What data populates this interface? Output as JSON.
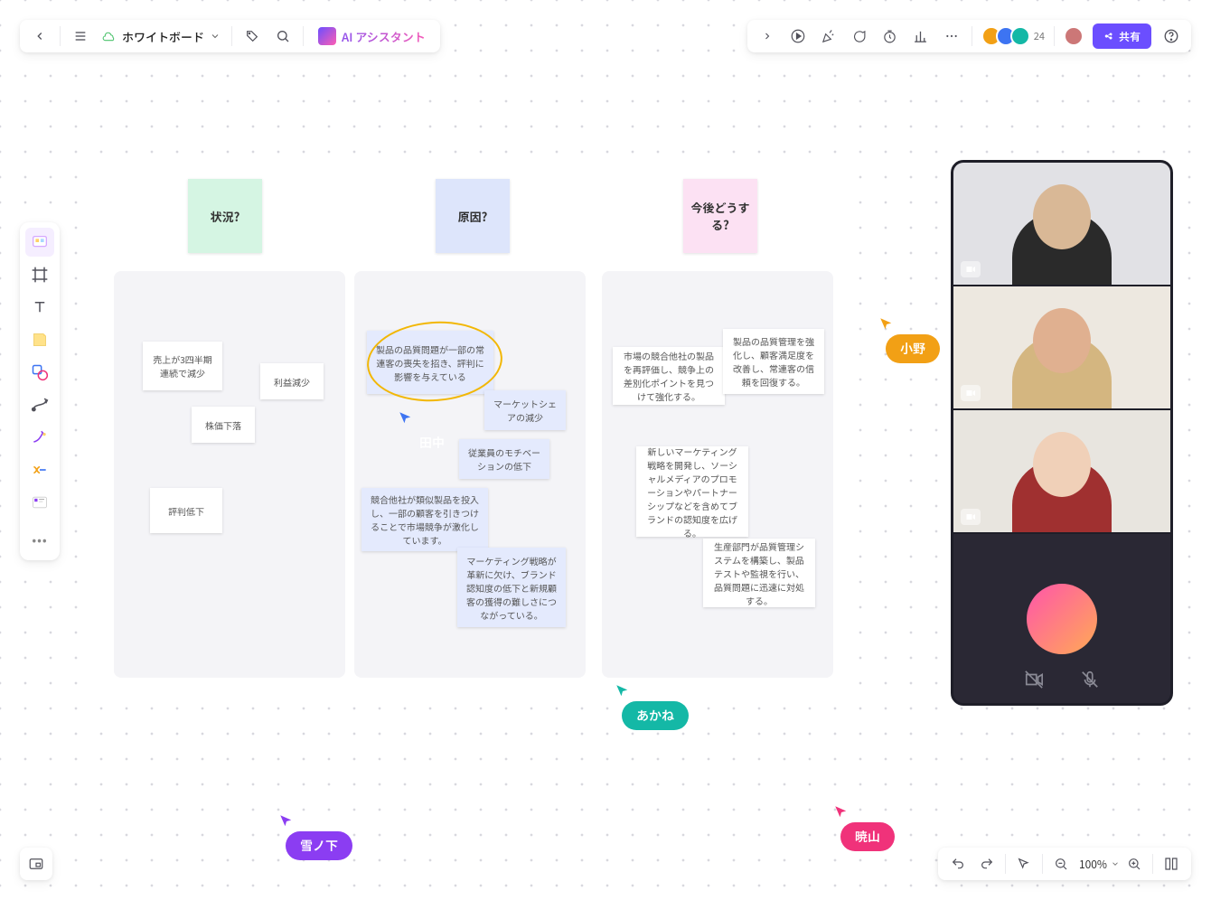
{
  "toolbar": {
    "title": "ホワイトボード",
    "ai_label": "AI アシスタント",
    "share_label": "共有",
    "avatar_count": "24",
    "zoom": "100%"
  },
  "headers": {
    "situation": "状況?",
    "cause": "原因?",
    "action": "今後どうする?"
  },
  "cursors": {
    "tanaka": "田中",
    "ono": "小野",
    "akane": "あかね",
    "akiyama": "暁山",
    "yukinoshita": "雪ノ下"
  },
  "colors": {
    "tanaka": "#3d74f2",
    "ono": "#f2a015",
    "akane": "#14b8a6",
    "akiyama": "#f0327a",
    "yukinoshita": "#8b3df2"
  },
  "notes": {
    "n1": "売上が3四半期連続で減少",
    "n2": "利益減少",
    "n3": "株価下落",
    "n4": "評判低下",
    "n5": "製品の品質問題が一部の常連客の喪失を招き、評判に影響を与えている",
    "n6": "マーケットシェアの減少",
    "n7": "従業員のモチベーションの低下",
    "n8": "競合他社が類似製品を投入し、一部の顧客を引きつけることで市場競争が激化しています。",
    "n9": "マーケティング戦略が革新に欠け、ブランド認知度の低下と新規顧客の獲得の難しさにつながっている。",
    "n10": "市場の競合他社の製品を再評価し、競争上の差別化ポイントを見つけて強化する。",
    "n11": "製品の品質管理を強化し、顧客満足度を改善し、常連客の信頼を回復する。",
    "n12": "新しいマーケティング戦略を開発し、ソーシャルメディアのプロモーションやパートナーシップなどを含めてブランドの認知度を広げる。",
    "n13": "生産部門が品質管理システムを構築し、製品テストや監視を行い、品質問題に迅速に対処する。"
  }
}
